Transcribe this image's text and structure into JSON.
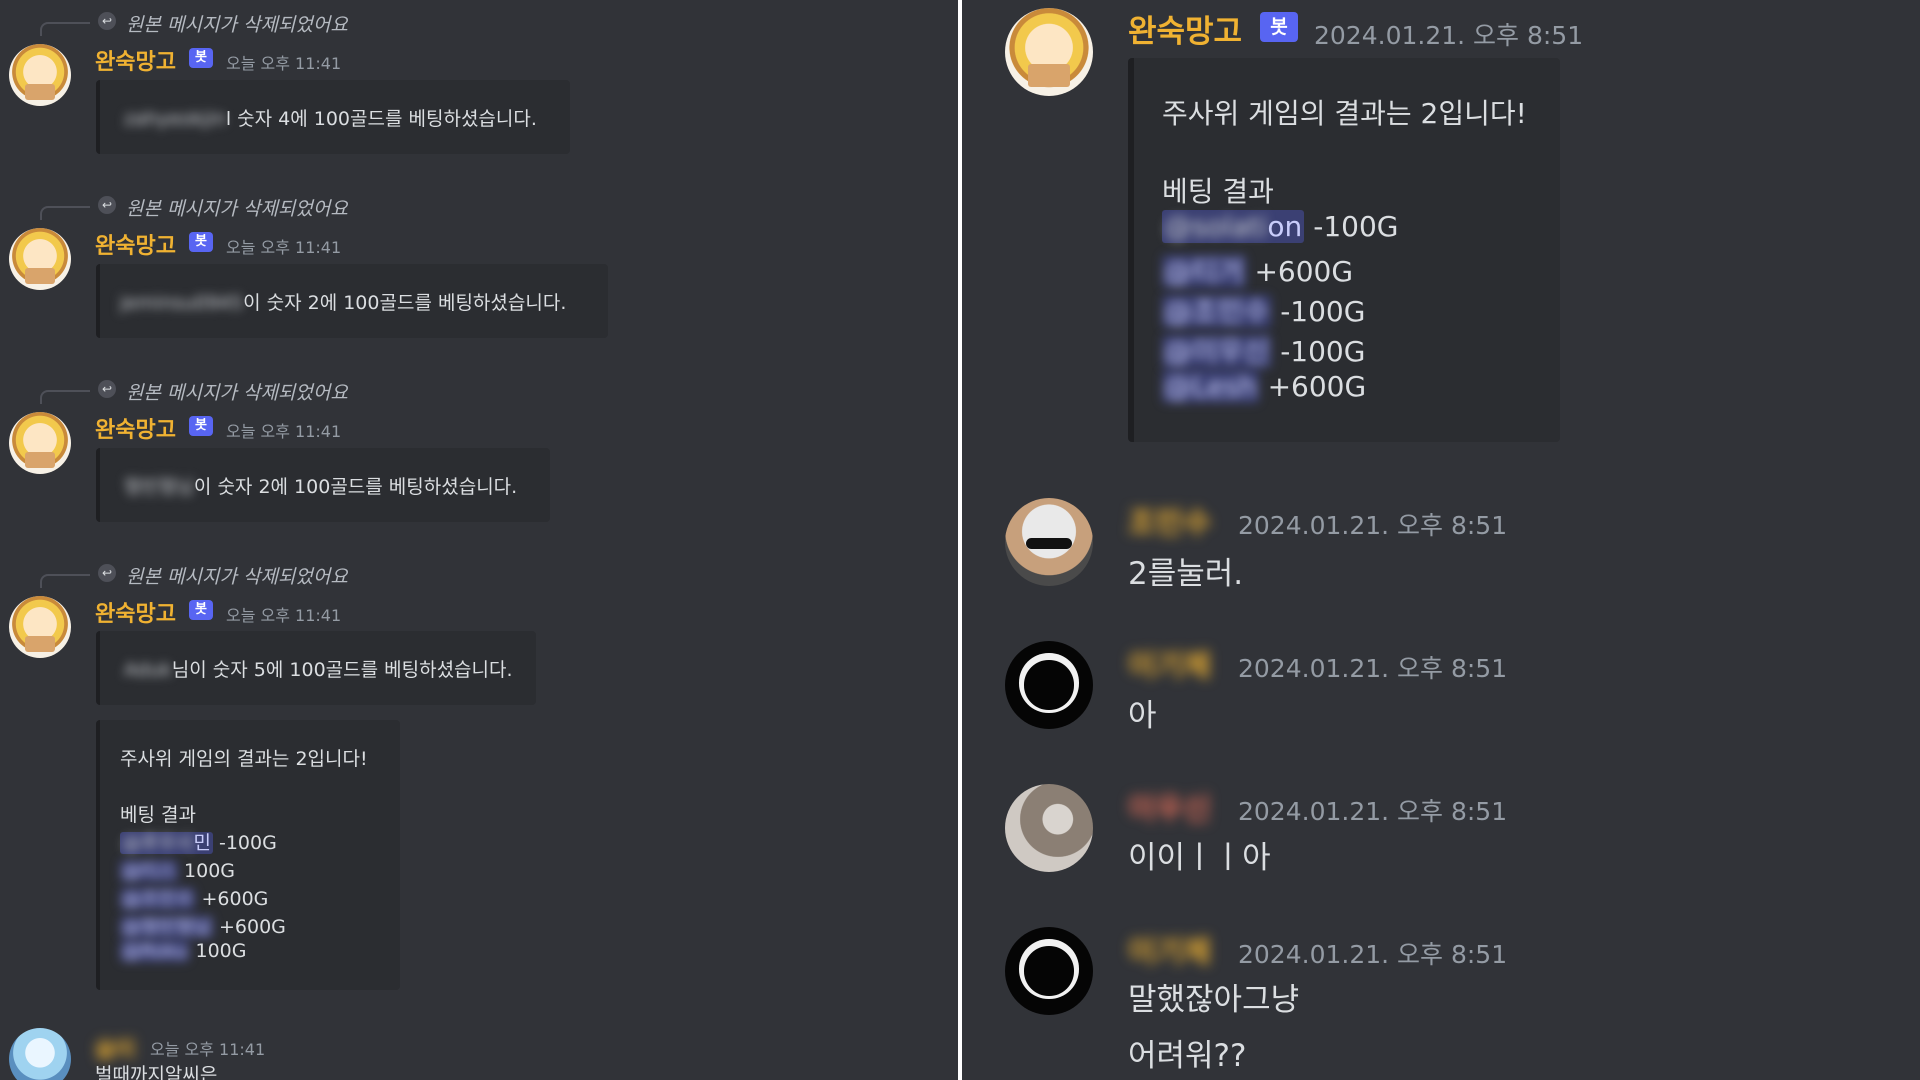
{
  "left": {
    "replies": [
      {
        "reply_text": "원본 메시지가 삭제되었어요",
        "author": "완숙망고",
        "bot_tag": "봇",
        "time": "오늘 오후 11:41",
        "user": "zahyeokjin",
        "text": "l 숫자 4에 100골드를 베팅하셨습니다."
      },
      {
        "reply_text": "원본 메시지가 삭제되었어요",
        "author": "완숙망고",
        "bot_tag": "봇",
        "time": "오늘 오후 11:41",
        "user": "jeminsu0945",
        "text": "이 숫자 2에 100골드를 베팅하셨습니다."
      },
      {
        "reply_text": "원본 메시지가 삭제되었어요",
        "author": "완숙망고",
        "bot_tag": "봇",
        "time": "오늘 오후 11:41",
        "user": "형빈형님",
        "text": "이 숫자 2에 100골드를 베팅하셨습니다."
      },
      {
        "reply_text": "원본 메시지가 삭제되었어요",
        "author": "완숙망고",
        "bot_tag": "봇",
        "time": "오늘 오후 11:41",
        "user": "Aduk",
        "text": "님이 숫자 5에 100골드를 베팅하셨습니다."
      }
    ],
    "result_embed": {
      "title": "주사위 게임의 결과는 2입니다!",
      "subtitle": "베팅 결과",
      "rows": [
        {
          "user": "@후우사",
          "tail": "민",
          "amount": "-100G"
        },
        {
          "user": "@티스",
          "tail": "",
          "amount": "100G"
        },
        {
          "user": "@조민수",
          "tail": "",
          "amount": "+600G"
        },
        {
          "user": "@형빈형님",
          "tail": "",
          "amount": "+600G"
        },
        {
          "user": "@Roku",
          "tail": "",
          "amount": "100G"
        }
      ]
    },
    "last_message": {
      "author": "슬미",
      "time": "오늘 오후 11:41",
      "text": "벌때까지알씨은"
    }
  },
  "right": {
    "bot_message": {
      "author": "완숙망고",
      "bot_tag": "봇",
      "time": "2024.01.21. 오후 8:51",
      "title": "주사위 게임의 결과는 2입니다!",
      "subtitle": "베팅 결과",
      "rows": [
        {
          "user": "@solati",
          "tail": "on",
          "amount": "-100G"
        },
        {
          "user": "@티거",
          "tail": "",
          "amount": "+600G"
        },
        {
          "user": "@조민수",
          "tail": "",
          "amount": "-100G"
        },
        {
          "user": "@이우신",
          "tail": "",
          "amount": "-100G"
        },
        {
          "user": "@Lesh",
          "tail": "",
          "amount": "+600G"
        }
      ]
    },
    "messages": [
      {
        "author": "조민수",
        "author_color": "#f0b232",
        "time": "2024.01.21. 오후 8:51",
        "texts": [
          "2를눌러."
        ]
      },
      {
        "author": "이기체",
        "author_color": "#f0b232",
        "time": "2024.01.21. 오후 8:51",
        "texts": [
          "아"
        ]
      },
      {
        "author": "이우신",
        "author_color": "#e8705a",
        "time": "2024.01.21. 오후 8:51",
        "texts": [
          "이이ㅣㅣ아"
        ]
      },
      {
        "author": "이기체",
        "author_color": "#f0b232",
        "time": "2024.01.21. 오후 8:51",
        "texts": [
          "말했잖아그냥",
          "어려워??"
        ]
      }
    ]
  }
}
